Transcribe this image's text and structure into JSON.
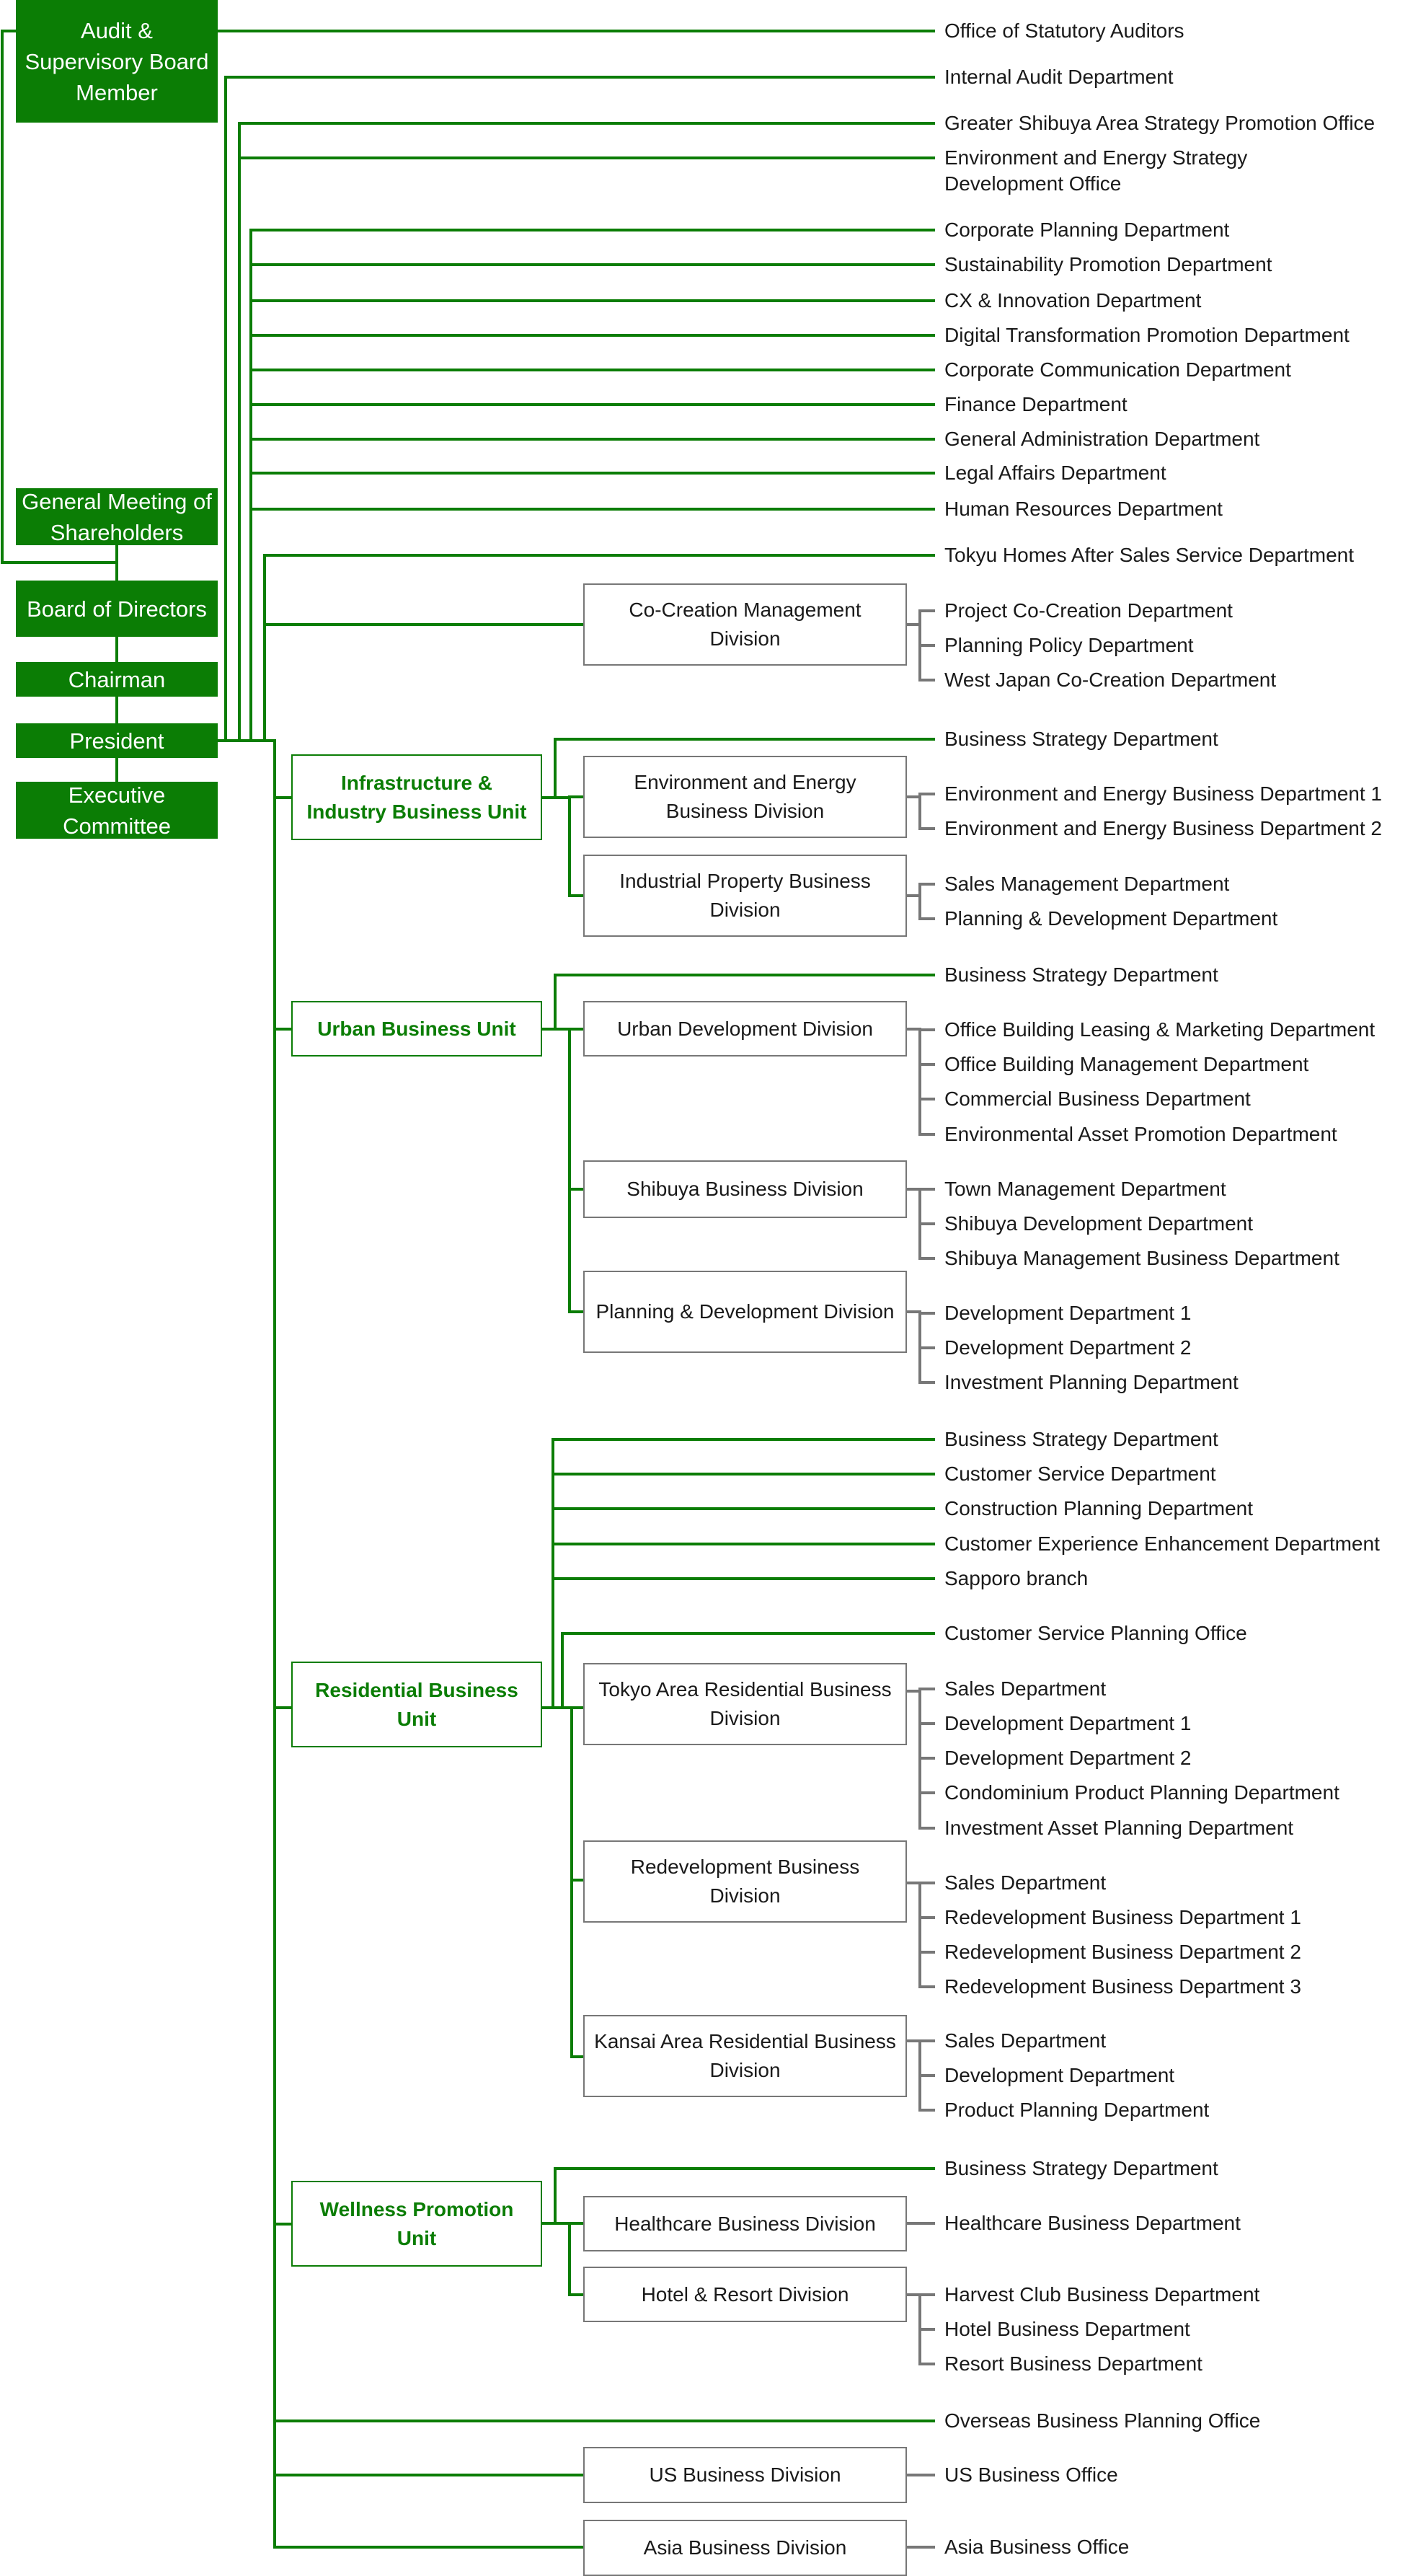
{
  "colors": {
    "accent": "#0b7d05",
    "division_border": "#777777",
    "text": "#1a1a1a"
  },
  "governance": {
    "audit_board": "Audit & Supervisory Board Member",
    "shareholders": "General Meeting of Shareholders",
    "board": "Board of Directors",
    "chairman": "Chairman",
    "president": "President",
    "executive_committee": "Executive Committee"
  },
  "audit_departments": [
    "Office of Statutory Auditors"
  ],
  "president_departments": [
    "Internal Audit Department",
    "Greater Shibuya Area Strategy Promotion Office",
    "Environment and Energy Strategy Development Office",
    "Corporate Planning Department",
    "Sustainability Promotion Department",
    "CX & Innovation Department",
    "Digital Transformation Promotion Department",
    "Corporate Communication Department",
    "Finance Department",
    "General Administration Department",
    "Legal Affairs Department",
    "Human Resources Department",
    "Tokyu Homes After Sales Service Department"
  ],
  "co_creation": {
    "name": "Co-Creation Management Division",
    "departments": [
      "Project Co-Creation Department",
      "Planning Policy Department",
      "West Japan Co-Creation Department"
    ]
  },
  "units": [
    {
      "name": "Infrastructure & Industry Business Unit",
      "direct": [
        "Business Strategy Department"
      ],
      "divisions": [
        {
          "name": "Environment and Energy Business Division",
          "departments": [
            "Environment and Energy Business Department 1",
            "Environment and Energy Business Department 2"
          ]
        },
        {
          "name": "Industrial Property Business Division",
          "departments": [
            "Sales Management Department",
            "Planning & Development Department"
          ]
        }
      ]
    },
    {
      "name": "Urban Business Unit",
      "direct": [
        "Business Strategy Department"
      ],
      "divisions": [
        {
          "name": "Urban Development Division",
          "departments": [
            "Office Building Leasing & Marketing Department",
            "Office Building Management Department",
            "Commercial Business Department",
            "Environmental Asset Promotion Department"
          ]
        },
        {
          "name": "Shibuya Business Division",
          "departments": [
            "Town Management Department",
            "Shibuya Development Department",
            "Shibuya Management Business Department"
          ]
        },
        {
          "name": "Planning & Development Division",
          "departments": [
            "Development Department 1",
            "Development Department 2",
            "Investment Planning Department"
          ]
        }
      ]
    },
    {
      "name": "Residential Business Unit",
      "direct": [
        "Business Strategy Department",
        "Customer Service Department",
        "Construction Planning Department",
        "Customer Experience Enhancement Department",
        "Sapporo branch"
      ],
      "office": "Customer Service Planning Office",
      "divisions": [
        {
          "name": "Tokyo Area Residential Business Division",
          "departments": [
            "Sales Department",
            "Development Department 1",
            "Development Department 2",
            "Condominium Product Planning Department",
            "Investment Asset Planning Department"
          ]
        },
        {
          "name": "Redevelopment Business Division",
          "departments": [
            "Sales Department",
            "Redevelopment Business Department 1",
            "Redevelopment Business Department 2",
            "Redevelopment Business Department 3"
          ]
        },
        {
          "name": "Kansai Area Residential Business Division",
          "departments": [
            "Sales Department",
            "Development Department",
            "Product Planning Department"
          ]
        }
      ]
    },
    {
      "name": "Wellness Promotion Unit",
      "direct": [
        "Business Strategy Department"
      ],
      "divisions": [
        {
          "name": "Healthcare Business Division",
          "departments": [
            "Healthcare Business Department"
          ]
        },
        {
          "name": "Hotel & Resort Division",
          "departments": [
            "Harvest Club Business Department",
            "Hotel Business Department",
            "Resort Business Department"
          ]
        }
      ]
    }
  ],
  "overseas": {
    "office": "Overseas Business Planning Office",
    "divisions": [
      {
        "name": "US Business Division",
        "departments": [
          "US Business Office"
        ]
      },
      {
        "name": "Asia Business Division",
        "departments": [
          "Asia Business Office"
        ]
      }
    ]
  }
}
